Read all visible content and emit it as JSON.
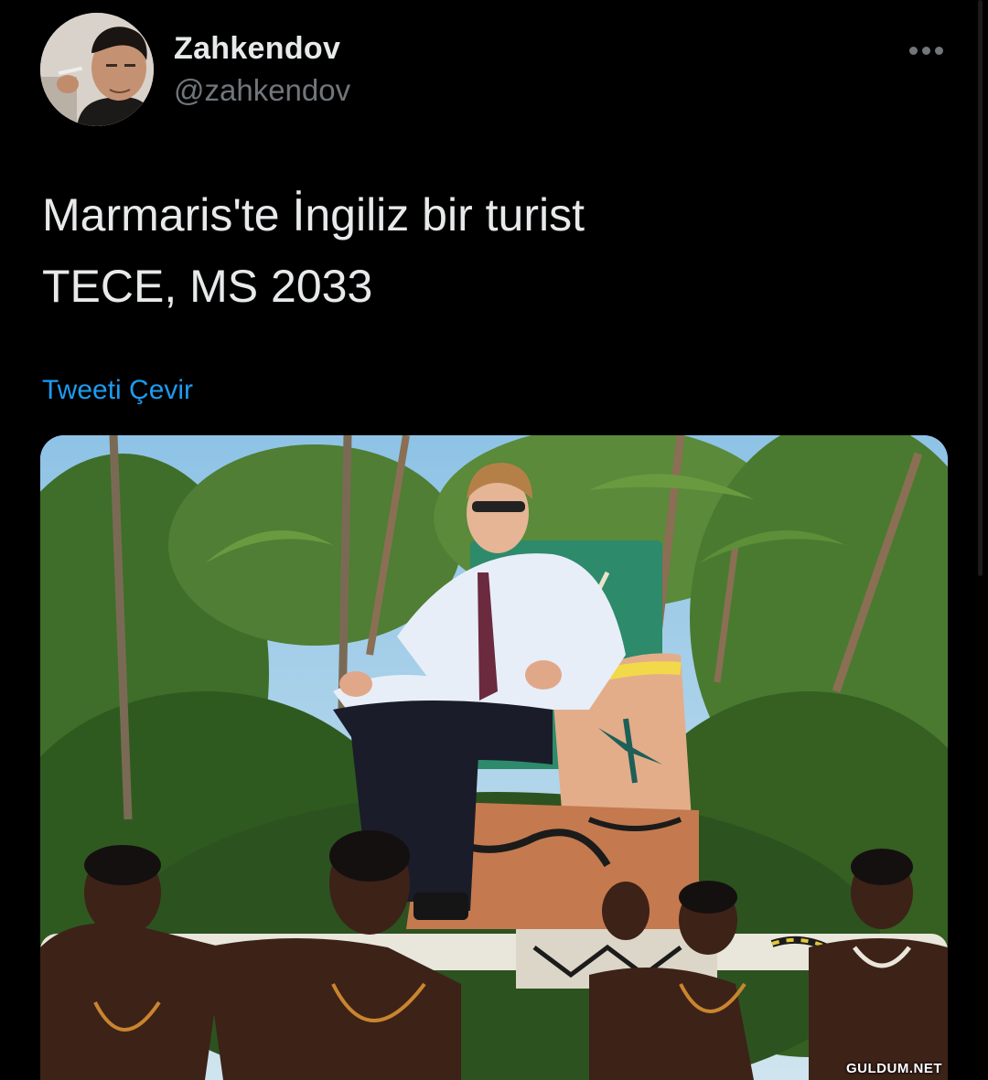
{
  "tweet": {
    "author_name": "Zahkendov",
    "author_handle": "@zahkendov",
    "text": "Marmaris'te İngiliz bir turist\nTECE, MS 2033",
    "translate_label": "Tweeti Çevir"
  },
  "watermark": "GULDUM.NET",
  "icons": {
    "more": "more-horizontal-icon"
  },
  "colors": {
    "background": "#000000",
    "link": "#1d9bf0",
    "secondary_text": "#71767b"
  }
}
